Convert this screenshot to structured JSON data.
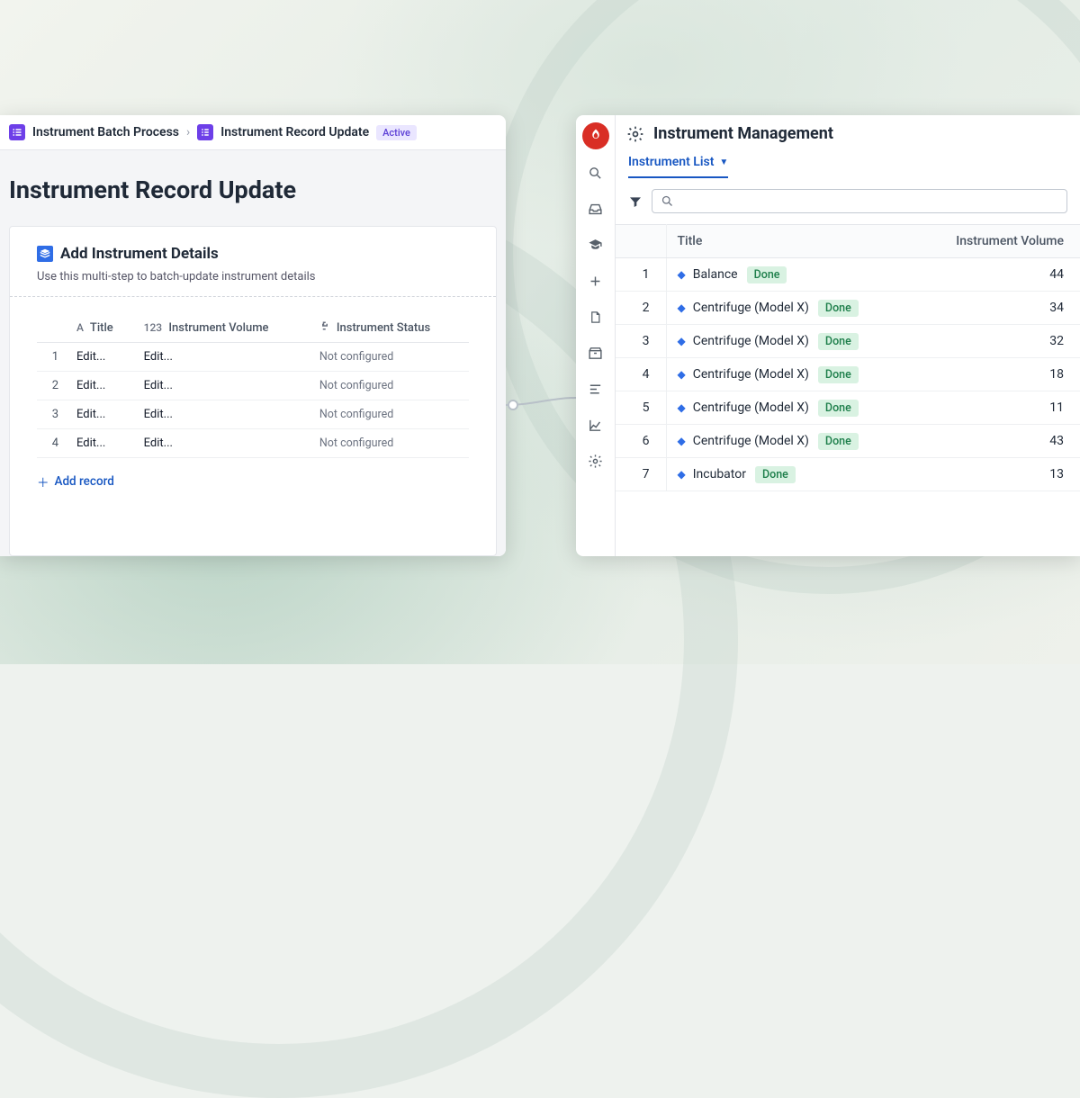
{
  "left": {
    "breadcrumb": {
      "parent": "Instrument Batch Process",
      "current": "Instrument Record Update",
      "badge": "Active"
    },
    "page_title": "Instrument Record Update",
    "card": {
      "title": "Add Instrument Details",
      "subtitle": "Use this multi-step to batch-update instrument details",
      "columns": {
        "title": "Title",
        "volume": "Instrument Volume",
        "status": "Instrument Status"
      },
      "rows": [
        {
          "n": "1",
          "title": "Edit...",
          "volume": "Edit...",
          "status": "Not configured"
        },
        {
          "n": "2",
          "title": "Edit...",
          "volume": "Edit...",
          "status": "Not configured"
        },
        {
          "n": "3",
          "title": "Edit...",
          "volume": "Edit...",
          "status": "Not configured"
        },
        {
          "n": "4",
          "title": "Edit...",
          "volume": "Edit...",
          "status": "Not configured"
        }
      ],
      "add_record": "Add record"
    }
  },
  "right": {
    "header": "Instrument Management",
    "tab": "Instrument List",
    "table": {
      "columns": {
        "title": "Title",
        "volume": "Instrument Volume"
      },
      "rows": [
        {
          "n": "1",
          "title": "Balance",
          "status": "Done",
          "volume": "44"
        },
        {
          "n": "2",
          "title": "Centrifuge (Model X)",
          "status": "Done",
          "volume": "34"
        },
        {
          "n": "3",
          "title": "Centrifuge (Model X)",
          "status": "Done",
          "volume": "32"
        },
        {
          "n": "4",
          "title": "Centrifuge (Model X)",
          "status": "Done",
          "volume": "18"
        },
        {
          "n": "5",
          "title": "Centrifuge (Model X)",
          "status": "Done",
          "volume": "11"
        },
        {
          "n": "6",
          "title": "Centrifuge (Model X)",
          "status": "Done",
          "volume": "43"
        },
        {
          "n": "7",
          "title": "Incubator",
          "status": "Done",
          "volume": "13"
        }
      ]
    }
  }
}
